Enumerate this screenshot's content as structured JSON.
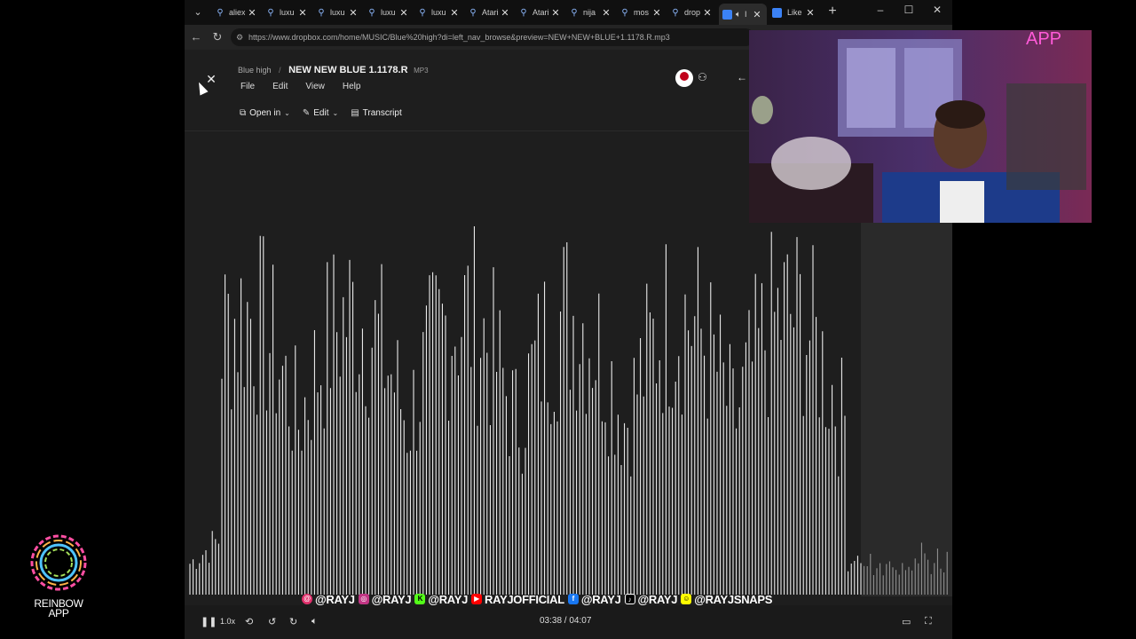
{
  "browser": {
    "tabs": [
      {
        "label": "aliex",
        "icon": "search-icon"
      },
      {
        "label": "luxu",
        "icon": "search-icon"
      },
      {
        "label": "luxu",
        "icon": "search-icon"
      },
      {
        "label": "luxu",
        "icon": "search-icon"
      },
      {
        "label": "luxu",
        "icon": "search-icon"
      },
      {
        "label": "Atari",
        "icon": "search-icon"
      },
      {
        "label": "Atari",
        "icon": "search-icon"
      },
      {
        "label": "nija",
        "icon": "search-icon"
      },
      {
        "label": "mos",
        "icon": "search-icon"
      },
      {
        "label": "drop",
        "icon": "search-icon"
      },
      {
        "label": "I",
        "icon": "dropbox-icon"
      },
      {
        "label": "Like",
        "icon": "dropbox-icon"
      }
    ],
    "url": "https://www.dropbox.com/home/MUSIC/Blue%20high?di=left_nav_browse&preview=NEW+NEW+BLUE+1.1178.R.mp3"
  },
  "viewer": {
    "folder": "Blue high",
    "file_name": "NEW NEW BLUE 1.1178.R",
    "file_ext": "MP3",
    "menu": [
      "File",
      "Edit",
      "View",
      "Help"
    ],
    "toolbar": {
      "open_in": "Open in",
      "edit": "Edit",
      "transcript": "Transcript"
    }
  },
  "player": {
    "speed": "1.0x",
    "time": "03:38 / 04:07",
    "progress": 0.883
  },
  "social": {
    "handles": [
      "@RAYJ",
      "@RAYJ",
      "@RAYJ",
      "RAYJOFFICIAL",
      "@RAYJ",
      "@RAYJ",
      "@RAYJSNAPS"
    ]
  },
  "webcam": {
    "neon_text": "APP"
  },
  "logo": {
    "line1": "REINBOW",
    "line2": "APP"
  },
  "colors": {
    "accent": "#0061fe",
    "waveform": "#ffffff",
    "background": "#1e1e1e"
  }
}
